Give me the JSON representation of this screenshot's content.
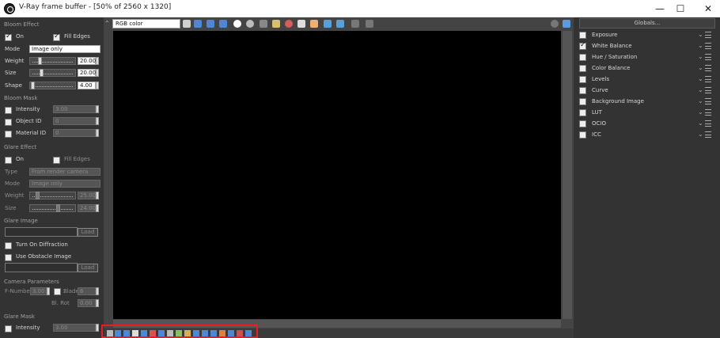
{
  "window": {
    "title": "V-Ray frame buffer - [50% of 2560 x 1320]",
    "minimize": "—",
    "maximize": "☐",
    "close": "✕"
  },
  "left": {
    "bloom_effect": "Bloom Effect",
    "on": "On",
    "fill_edges": "Fill Edges",
    "mode": "Mode",
    "mode_value": "Image only",
    "weight": "Weight",
    "weight_value": "20.00",
    "size": "Size",
    "size_value": "20.00",
    "shape": "Shape",
    "shape_value": "4.00",
    "bloom_mask": "Bloom Mask",
    "intensity": "Intensity",
    "intensity_value": "3.00",
    "object_id": "Object ID",
    "object_id_value": "0",
    "material_id": "Material ID",
    "material_id_value": "0",
    "glare_effect": "Glare Effect",
    "glare_on": "On",
    "glare_fill": "Fill Edges",
    "type": "Type",
    "type_value": "From render camera",
    "glare_mode": "Mode",
    "glare_mode_value": "Image only",
    "glare_weight": "Weight",
    "glare_weight_value": "25.00",
    "glare_size": "Size",
    "glare_size_value": "24.00",
    "glare_image": "Glare Image",
    "load": "Load",
    "turn_on_diffraction": "Turn On Diffraction",
    "use_obstacle": "Use Obstacle Image",
    "load2": "Load",
    "camera_params": "Camera Parameters",
    "f_number": "F-Numbe",
    "f_value": "3.00",
    "blades": "Blade",
    "blades_value": "6",
    "rot": "Bl. Rot",
    "rot_value": "0.00",
    "glare_mask": "Glare Mask",
    "glare_mask_intensity": "Intensity",
    "glare_mask_value": "3.00"
  },
  "viewer": {
    "channel": "RGB color",
    "icons": [
      "paint-icon",
      "red-icon",
      "green-icon",
      "blue-icon",
      "white-dot-icon",
      "gray-dot-icon",
      "save-icon",
      "folder-icon",
      "stop-icon",
      "cursor-icon",
      "crosshair-icon",
      "render-icon",
      "region-icon",
      "lock-icon"
    ]
  },
  "right": {
    "globals": "Globals...",
    "items": [
      {
        "label": "Exposure",
        "checked": false
      },
      {
        "label": "White Balance",
        "checked": true
      },
      {
        "label": "Hue / Saturation",
        "checked": false
      },
      {
        "label": "Color Balance",
        "checked": false
      },
      {
        "label": "Levels",
        "checked": false
      },
      {
        "label": "Curve",
        "checked": false
      },
      {
        "label": "Background Image",
        "checked": false
      },
      {
        "label": "LUT",
        "checked": false
      },
      {
        "label": "OCIO",
        "checked": false
      },
      {
        "label": "ICC",
        "checked": false
      }
    ]
  }
}
